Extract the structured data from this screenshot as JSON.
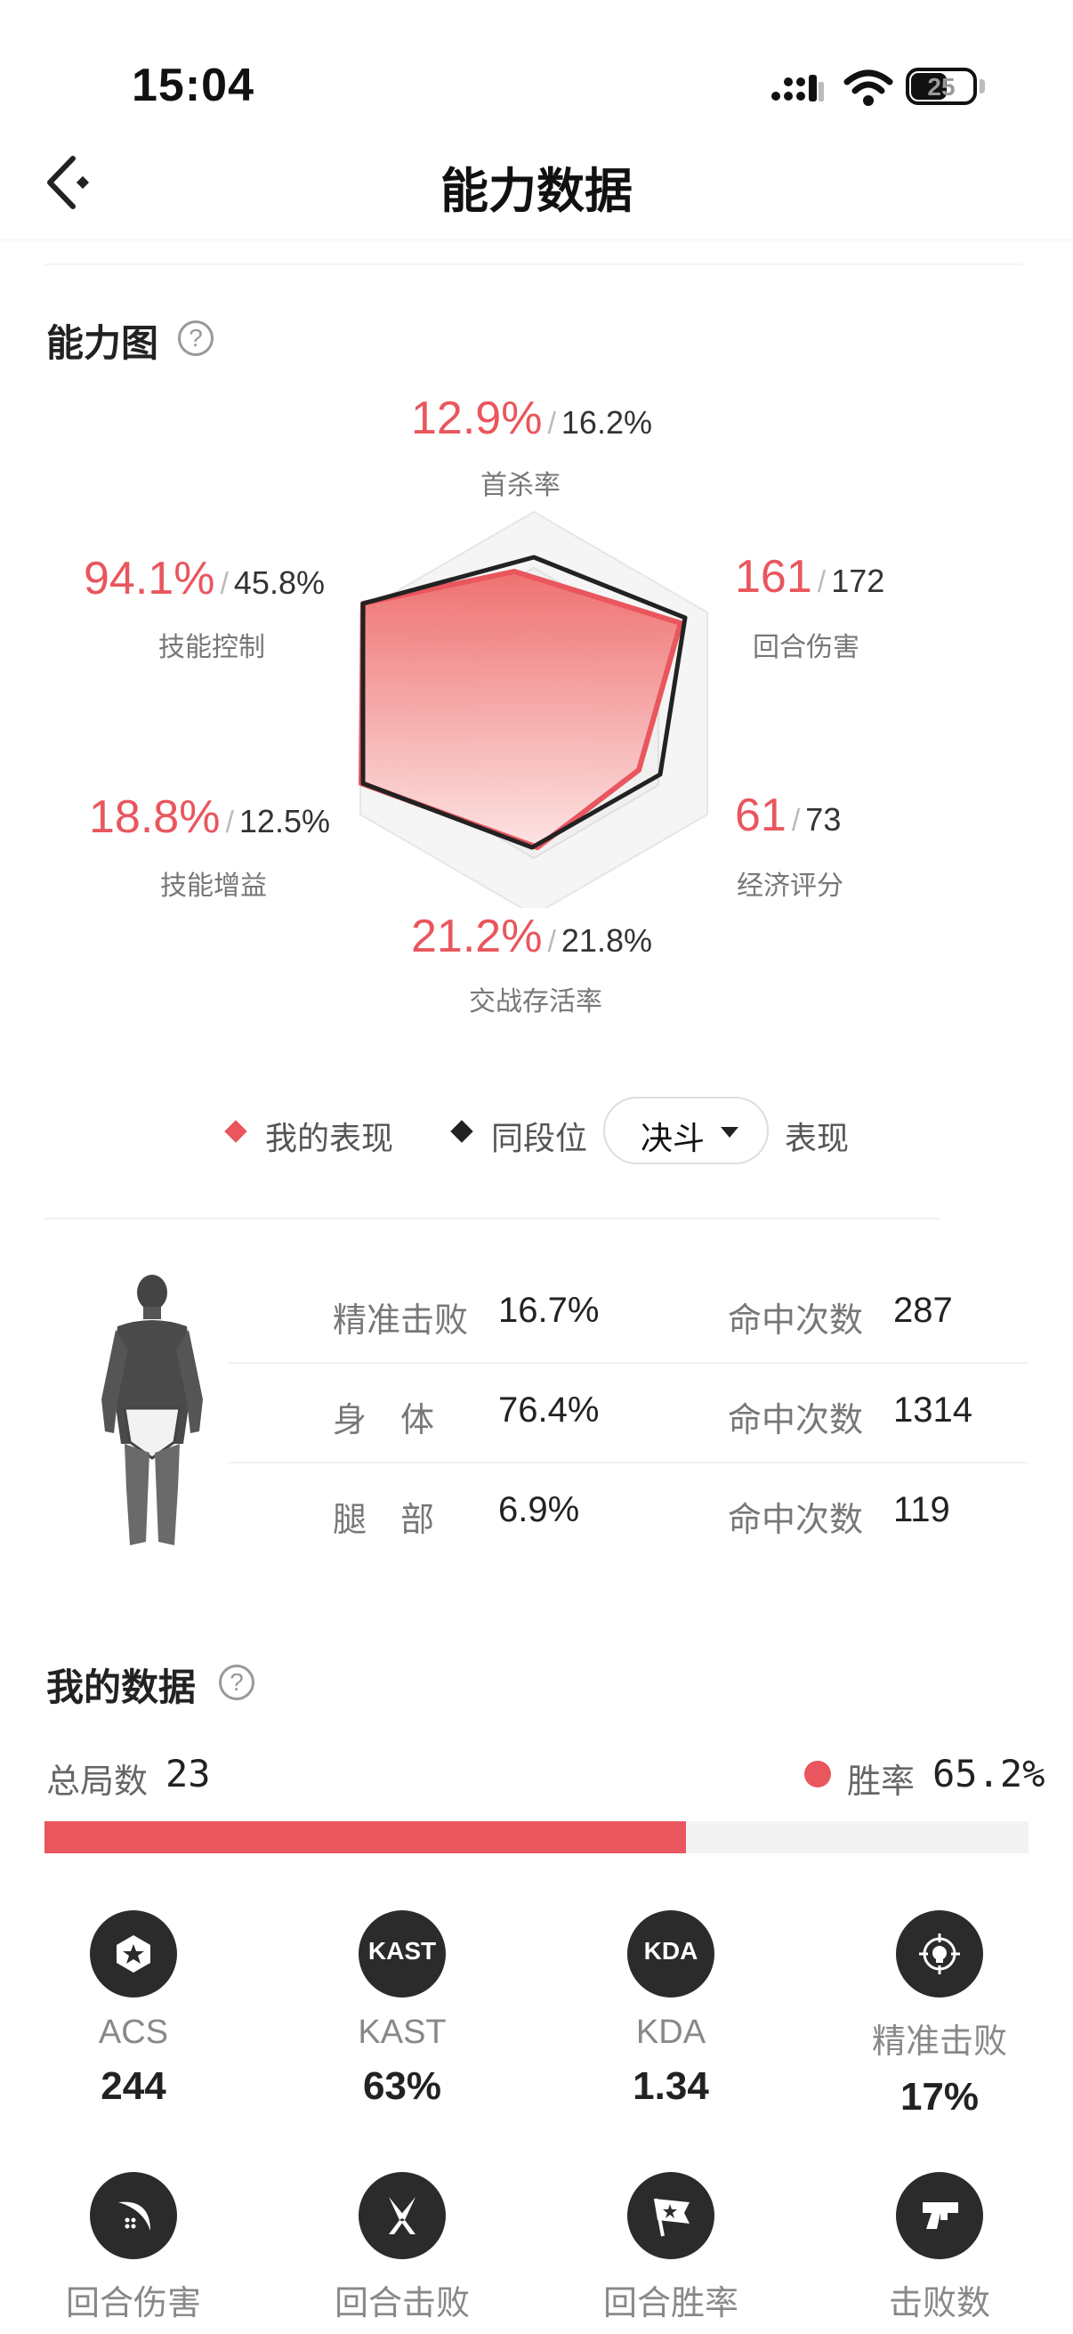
{
  "status_bar": {
    "time": "15:04",
    "battery": "25"
  },
  "header": {
    "title": "能力数据"
  },
  "ability": {
    "title": "能力图",
    "help_icon": "question-circle-icon",
    "stats": {
      "first_kill": {
        "mine": "12.9%",
        "avg": "16.2%",
        "label": "首杀率"
      },
      "round_damage": {
        "mine": "161",
        "avg": "172",
        "label": "回合伤害"
      },
      "economy": {
        "mine": "61",
        "avg": "73",
        "label": "经济评分"
      },
      "survival": {
        "mine": "21.2%",
        "avg": "21.8%",
        "label": "交战存活率"
      },
      "skill_buff": {
        "mine": "18.8%",
        "avg": "12.5%",
        "label": "技能增益"
      },
      "skill_control": {
        "mine": "94.1%",
        "avg": "45.8%",
        "label": "技能控制"
      }
    },
    "legend": {
      "mine": "我的表现",
      "rank": "同段位",
      "rank_value": "决斗",
      "suffix": "表现"
    },
    "colors": {
      "mine": "#e9565d",
      "rank": "#222222"
    }
  },
  "hit_regions": [
    {
      "label": "精准击败",
      "pct": "16.7%",
      "count_label": "命中次数",
      "count": "287"
    },
    {
      "label": "身　体",
      "pct": "76.4%",
      "count_label": "命中次数",
      "count": "1314"
    },
    {
      "label": "腿　部",
      "pct": "6.9%",
      "count_label": "命中次数",
      "count": "119"
    }
  ],
  "my_data": {
    "title": "我的数据",
    "help_icon": "question-circle-icon",
    "games_label": "总局数",
    "games_value": "23",
    "win_label": "胜率",
    "win_value": "65.2%",
    "win_rate": 0.652,
    "metrics": [
      {
        "icon": "star-badge-icon",
        "label": "ACS",
        "value": "244"
      },
      {
        "icon": "kast-icon",
        "icon_text": "KAST",
        "label": "KAST",
        "value": "63%"
      },
      {
        "icon": "kda-icon",
        "icon_text": "KDA",
        "label": "KDA",
        "value": "1.34"
      },
      {
        "icon": "crosshair-skull-icon",
        "label": "精准击败",
        "value": "17%"
      },
      {
        "icon": "slash-damage-icon",
        "label": "回合伤害"
      },
      {
        "icon": "crossed-blades-icon",
        "label": "回合击败"
      },
      {
        "icon": "flag-icon",
        "label": "回合胜率"
      },
      {
        "icon": "gun-icon",
        "label": "击败数"
      }
    ]
  }
}
